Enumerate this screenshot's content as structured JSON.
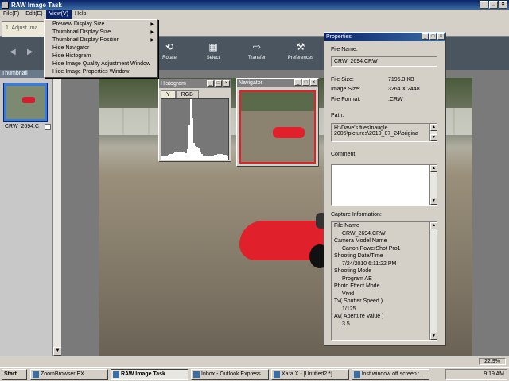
{
  "window": {
    "title": "RAW Image Task",
    "buttons": [
      "_",
      "□",
      "×"
    ]
  },
  "menubar": [
    "File(F)",
    "Edit(E)",
    "View(V)",
    "Help"
  ],
  "view_menu": {
    "items": [
      {
        "label": "Preview Display Size",
        "submenu": true
      },
      {
        "label": "Thumbnail Display Size",
        "submenu": true
      },
      {
        "label": "Thumbnail Display Position",
        "submenu": true
      },
      {
        "label": "Hide Navigator",
        "submenu": false
      },
      {
        "label": "Hide Histogram",
        "submenu": false
      },
      {
        "label": "Hide Image Quality Adjustment Window",
        "submenu": false
      },
      {
        "label": "Hide Image Properties Window",
        "submenu": false
      }
    ]
  },
  "tab": {
    "label": "1. Adjust Ima"
  },
  "toolbar": {
    "rotate": "Rotate",
    "select": "Select",
    "transfer": "Transfer",
    "preferences": "Preferences"
  },
  "thumbnail": {
    "header": "Thumbnail",
    "filename": "CRW_2694.C"
  },
  "histogram": {
    "title": "Histogram",
    "tab_y": "Y",
    "tab_rgb": "RGB"
  },
  "navigator": {
    "title": "Navigator"
  },
  "properties": {
    "title": "Properties",
    "file_name_label": "File Name:",
    "file_name": "CRW_2694.CRW",
    "file_size_label": "File Size:",
    "file_size": "7195.3 KB",
    "image_size_label": "Image Size:",
    "image_size": "3264 X 2448",
    "file_format_label": "File Format:",
    "file_format": ".CRW",
    "path_label": "Path:",
    "path_line1": "H:\\Dave's files\\naugle",
    "path_line2": "2005\\pictures\\2010_07_24\\origina",
    "comment_label": "Comment:",
    "capture_label": "Capture Information:",
    "capture_lines": [
      {
        "text": "File Name",
        "val": false
      },
      {
        "text": "CRW_2694.CRW",
        "val": true
      },
      {
        "text": "Camera Model Name",
        "val": false
      },
      {
        "text": "Canon PowerShot Pro1",
        "val": true
      },
      {
        "text": "Shooting Date/Time",
        "val": false
      },
      {
        "text": "7/24/2010 6:11:22 PM",
        "val": true
      },
      {
        "text": "Shooting Mode",
        "val": false
      },
      {
        "text": "Program AE",
        "val": true
      },
      {
        "text": "Photo Effect Mode",
        "val": false
      },
      {
        "text": "Vivid",
        "val": true
      },
      {
        "text": "Tv( Shutter Speed )",
        "val": false
      },
      {
        "text": "1/125",
        "val": true
      },
      {
        "text": "Av( Aperture Value )",
        "val": false
      },
      {
        "text": "3.5",
        "val": true
      }
    ]
  },
  "status": {
    "zoom": "22.9%"
  },
  "taskbar": {
    "start": "Start",
    "tasks": [
      "ZoomBrowser EX",
      "RAW Image Task",
      "Inbox - Outlook Express",
      "Xara X - [Untitled2 *]",
      "lost window off screen : ..."
    ],
    "clock": "9:19 AM"
  }
}
